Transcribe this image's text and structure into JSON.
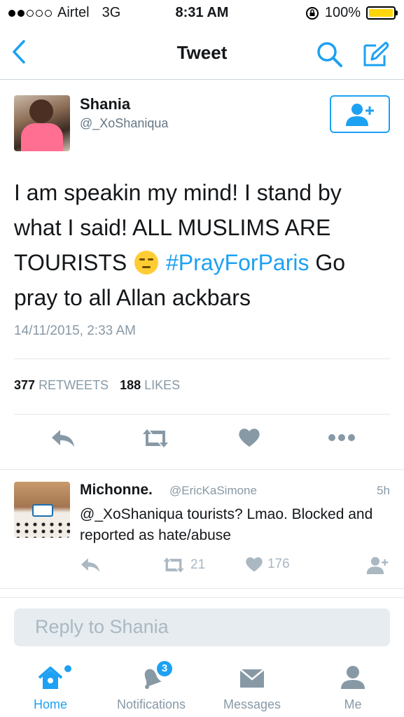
{
  "status_bar": {
    "carrier": "Airtel",
    "network": "3G",
    "time": "8:31 AM",
    "battery": "100%",
    "signal_bars_filled": 2,
    "signal_bars_total": 5,
    "battery_color": "#ffd60a"
  },
  "nav": {
    "title": "Tweet",
    "back_icon": "chevron-left-icon",
    "search_icon": "search-icon",
    "compose_icon": "compose-icon"
  },
  "tweet": {
    "author_name": "Shania",
    "author_handle": "@_XoShaniqua",
    "text_part1": "I am speakin my mind! I stand by what I said! ALL MUSLIMS ARE TOURISTS ",
    "emoji": "unamused-face-emoji",
    "hashtag": "#PrayForParis",
    "text_part2": " Go pray to all Allan ackbars",
    "date": "14/11/2015, 2:33 AM",
    "retweet_count": "377",
    "retweet_label": "RETWEETS",
    "like_count": "188",
    "like_label": "LIKES"
  },
  "reply": {
    "name": "Michonne.",
    "handle": "@EricKaSimone",
    "time": "5h",
    "text": "@_XoShaniqua tourists? Lmao. Blocked and reported as hate/abuse",
    "retweet_count": "21",
    "like_count": "176"
  },
  "reply_box": {
    "placeholder": "Reply to Shania"
  },
  "tabs": [
    {
      "label": "Home",
      "icon": "home-icon",
      "active": true
    },
    {
      "label": "Notifications",
      "icon": "bell-icon",
      "badge": "3"
    },
    {
      "label": "Messages",
      "icon": "envelope-icon"
    },
    {
      "label": "Me",
      "icon": "person-icon"
    }
  ],
  "colors": {
    "accent": "#1da1f2",
    "muted": "#8899a6",
    "divider": "#e1e8ed"
  }
}
